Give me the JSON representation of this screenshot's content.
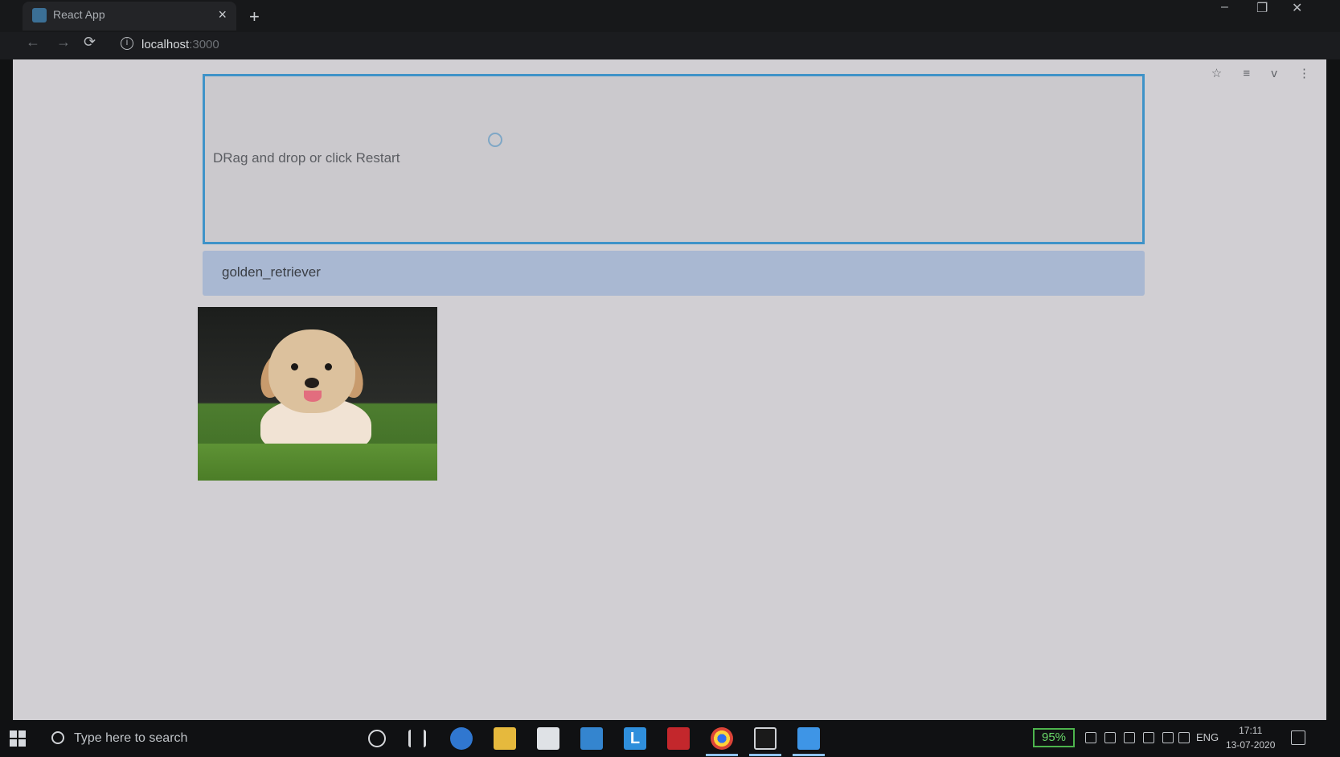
{
  "browser": {
    "tab_title": "React App",
    "tab_close": "×",
    "new_tab": "+",
    "url_host": "localhost",
    "url_port": ":3000",
    "nav": {
      "back": "←",
      "forward": "→",
      "reload": "⟳"
    },
    "window": {
      "minimize": "–",
      "maximize": "❐",
      "close": "✕"
    },
    "right_tools": {
      "star": "☆",
      "reading_list": "≡",
      "avatar": "v",
      "menu": "⋮"
    }
  },
  "page": {
    "dropzone_text": "DRag and drop or click Restart",
    "prediction": "golden_retriever",
    "image_alt": "golden retriever puppy lying on grass"
  },
  "taskbar": {
    "search_placeholder": "Type here to search",
    "apps": [
      "cortana-icon",
      "task-view-icon",
      "edge-icon",
      "file-explorer-icon",
      "store-icon",
      "mail-icon",
      "l-app-icon",
      "mcafee-icon",
      "chrome-icon",
      "cmd-icon",
      "vscode-icon"
    ],
    "l_app_label": "L",
    "battery": "95%",
    "language": "ENG",
    "time": "17:11",
    "date": "13-07-2020"
  }
}
